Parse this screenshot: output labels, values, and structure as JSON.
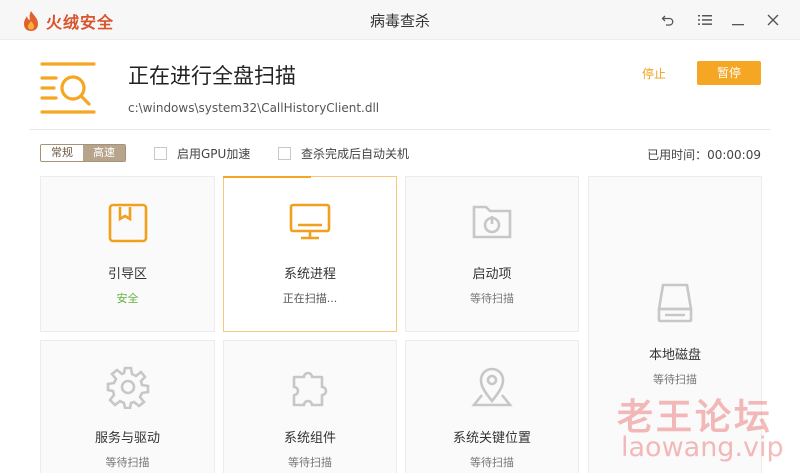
{
  "app": {
    "logo_text": "火绒安全",
    "window_title": "病毒查杀"
  },
  "colors": {
    "accent": "#f5a623",
    "safe": "#65b23c",
    "icon_active": "#f0a01d",
    "icon_inactive": "#c7c7c7"
  },
  "header": {
    "title": "正在进行全盘扫描",
    "current_file": "c:\\windows\\system32\\CallHistoryClient.dll",
    "stop_label": "停止",
    "pause_label": "暂停"
  },
  "options": {
    "mode_normal": "常规",
    "mode_fast": "高速",
    "mode_selected": "高速",
    "gpu_label": "启用GPU加速",
    "gpu_checked": false,
    "shutdown_label": "查杀完成后自动关机",
    "shutdown_checked": false,
    "elapsed": "已用时间：00:00:09"
  },
  "cards": [
    {
      "name": "引导区",
      "status": "安全",
      "icon": "boot-sector-icon",
      "state": "safe"
    },
    {
      "name": "系统进程",
      "status": "正在扫描...",
      "icon": "monitor-icon",
      "state": "scanning"
    },
    {
      "name": "启动项",
      "status": "等待扫描",
      "icon": "startup-icon",
      "state": "waiting"
    },
    {
      "name": "本地磁盘",
      "status": "等待扫描",
      "icon": "disk-icon",
      "state": "waiting"
    },
    {
      "name": "服务与驱动",
      "status": "等待扫描",
      "icon": "gear-icon",
      "state": "waiting"
    },
    {
      "name": "系统组件",
      "status": "等待扫描",
      "icon": "puzzle-icon",
      "state": "waiting"
    },
    {
      "name": "系统关键位置",
      "status": "等待扫描",
      "icon": "location-pin-icon",
      "state": "waiting"
    }
  ],
  "watermark": {
    "main": "老王论坛",
    "sub": "laowang.vip"
  }
}
